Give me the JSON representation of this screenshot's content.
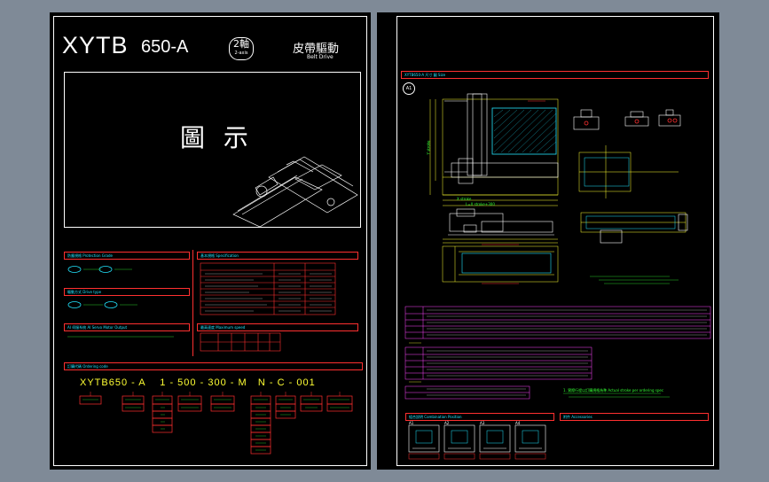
{
  "left_sheet": {
    "title_main": "XYTB",
    "title_model": "650-A",
    "axis_badge": "2軸",
    "axis_badge_sub": "2-axis",
    "drive_cn": "皮帶驅動",
    "drive_en": "Belt Drive",
    "figure_label": "圖  示",
    "section_dust": "防塵規格 Protection Grade",
    "section_spec": "基本規格 Specification",
    "section_motor": "驅動方式 Drive type",
    "section_speed": "最高速度 Maximum speed",
    "section_ai": "AI 伺服系統 AI Servo Motor Output",
    "section_order": "訂購代碼 Ordering code",
    "order_code": [
      "XYTB650",
      "-",
      "A",
      "1",
      "-",
      "500",
      "-",
      "300",
      "-",
      "M",
      "N",
      "-",
      "C",
      "-",
      "001"
    ],
    "spec_rows": [
      "項目 Item",
      "重複精度 Repeatability",
      "定位精度 Positioning",
      "最大負載 Max load",
      "最大速度 Max speed",
      "有效行程 Effective stroke",
      "AI 伺服 AI Servo",
      "馬達功率 Motor power"
    ]
  },
  "right_sheet": {
    "header": "XYTB650-A 尺寸 圖 Size",
    "circle_label": "A1",
    "section_combination": "組合說明 Combination Position",
    "section_accessory": "附件 Accessories",
    "combo_tags": [
      "A1",
      "A2",
      "A3",
      "A4"
    ],
    "dim_labels": [
      "X stroke",
      "Y stroke",
      "L=X stroke+300"
    ],
    "note_text": "1. 實際行程以訂購規格為準 Actual stroke per ordering spec",
    "table_rows": [
      "X",
      "Y",
      "A",
      "B",
      "C",
      "M"
    ]
  },
  "colors": {
    "background": "#7f8a97",
    "sheet": "#000000",
    "red": "#ff3030",
    "cyan": "#22e5ff",
    "green": "#33ff33",
    "yellow": "#ffff33",
    "magenta": "#ff44ff"
  }
}
